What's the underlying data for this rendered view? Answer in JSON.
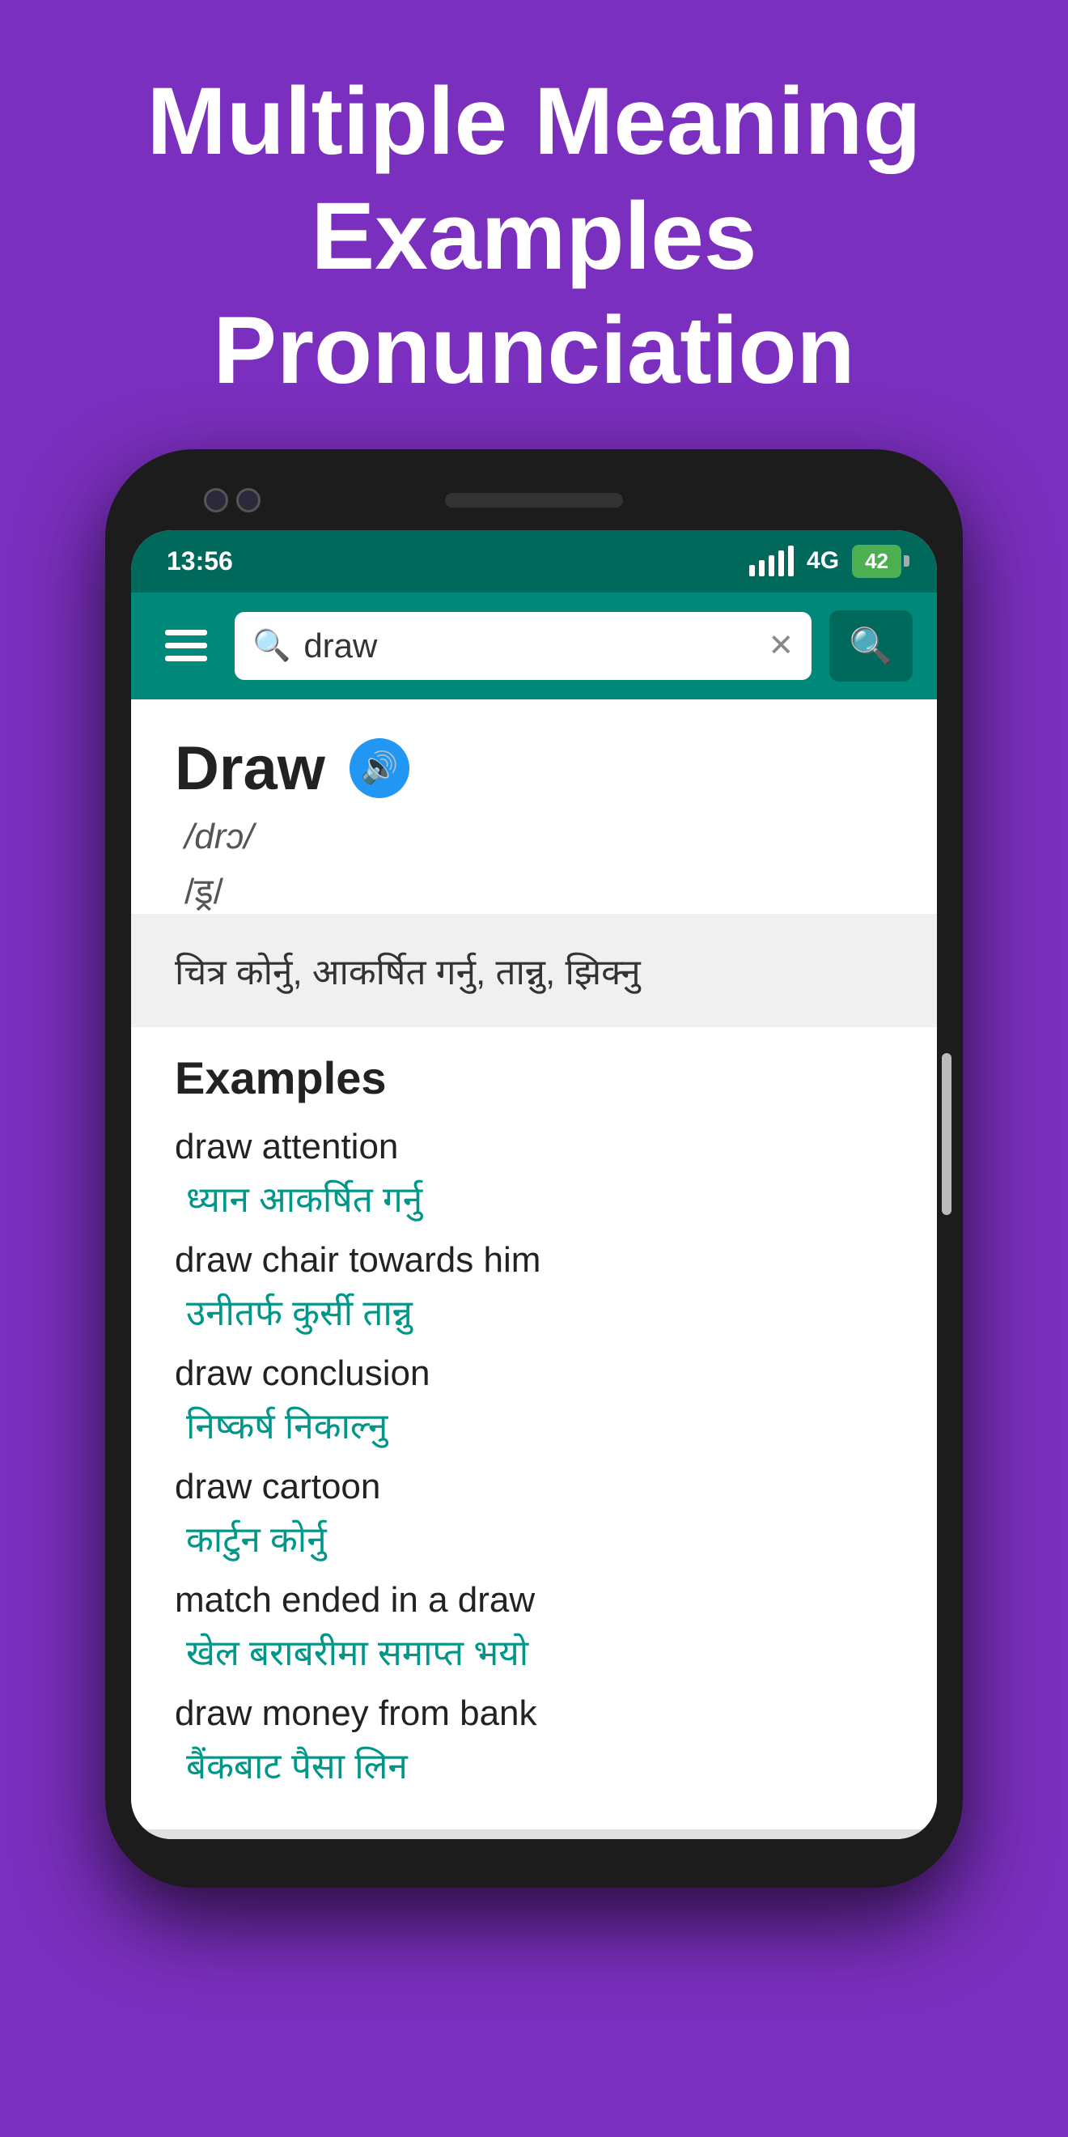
{
  "header": {
    "title": "Multiple Meaning\nExamples\nPronunciation",
    "background_color": "#7B2FBE"
  },
  "status_bar": {
    "time": "13:56",
    "network": "4G",
    "battery": "42"
  },
  "toolbar": {
    "menu_label": "☰",
    "search_placeholder": "draw",
    "search_value": "draw",
    "clear_label": "✕",
    "search_btn_label": "🔍"
  },
  "word": {
    "title": "Draw",
    "pronunciation_en": "/drɔ/",
    "pronunciation_ne": "/ड्र/",
    "meaning": "चित्र कोर्नु, आकर्षित गर्नु, तान्नु, झिक्नु"
  },
  "examples": {
    "section_title": "Examples",
    "items": [
      {
        "en": "draw attention",
        "ne": "ध्यान आकर्षित गर्नु"
      },
      {
        "en": "draw chair towards him",
        "ne": "उनीतर्फ कुर्सी तान्नु"
      },
      {
        "en": "draw conclusion",
        "ne": "निष्कर्ष निकाल्नु"
      },
      {
        "en": "draw cartoon",
        "ne": "कार्टुन कोर्नु"
      },
      {
        "en": "match ended in a draw",
        "ne": "खेल बराबरीमा समाप्त भयो"
      },
      {
        "en": "draw money from bank",
        "ne": "बैंकबाट पैसा लिन"
      }
    ]
  }
}
